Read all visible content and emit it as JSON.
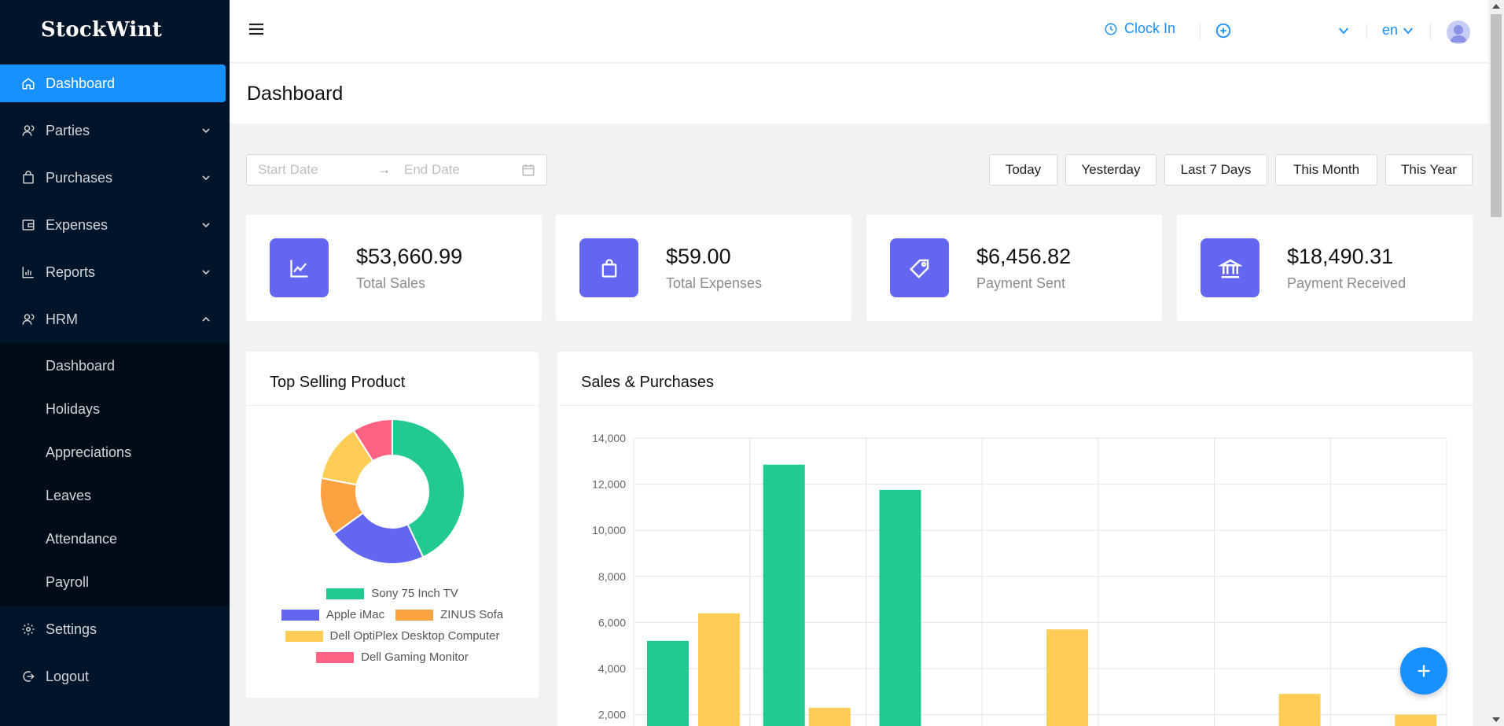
{
  "app": {
    "brand": "StockWint"
  },
  "sidebar": {
    "items": [
      {
        "label": "Dashboard",
        "icon": "home-icon",
        "active": true
      },
      {
        "label": "Parties",
        "icon": "users-icon",
        "expandable": true
      },
      {
        "label": "Purchases",
        "icon": "shopping-bag-icon",
        "expandable": true
      },
      {
        "label": "Expenses",
        "icon": "wallet-icon",
        "expandable": true
      },
      {
        "label": "Reports",
        "icon": "bar-chart-icon",
        "expandable": true
      },
      {
        "label": "HRM",
        "icon": "user-group-icon",
        "expandable": true,
        "expanded": true
      }
    ],
    "hrm_sub": [
      "Dashboard",
      "Holidays",
      "Appreciations",
      "Leaves",
      "Attendance",
      "Payroll"
    ],
    "bottom": [
      {
        "label": "Settings",
        "icon": "gear-icon"
      },
      {
        "label": "Logout",
        "icon": "logout-icon"
      }
    ]
  },
  "header": {
    "clock_in": "Clock In",
    "lang": "en"
  },
  "page": {
    "title": "Dashboard"
  },
  "filters": {
    "start_placeholder": "Start Date",
    "end_placeholder": "End Date",
    "arrow": "→",
    "quick": [
      "Today",
      "Yesterday",
      "Last 7 Days",
      "This Month",
      "This Year"
    ]
  },
  "stats": [
    {
      "value": "$53,660.99",
      "label": "Total Sales",
      "icon": "line-chart-icon"
    },
    {
      "value": "$59.00",
      "label": "Total Expenses",
      "icon": "shopping-bag-icon"
    },
    {
      "value": "$6,456.82",
      "label": "Payment Sent",
      "icon": "tag-icon"
    },
    {
      "value": "$18,490.31",
      "label": "Payment Received",
      "icon": "bank-icon"
    }
  ],
  "top_selling": {
    "title": "Top Selling Product",
    "legend": [
      {
        "name": "Sony 75 Inch TV",
        "color": "#22c993"
      },
      {
        "name": "Apple iMac",
        "color": "#6366f1"
      },
      {
        "name": "ZINUS Sofa",
        "color": "#fda240"
      },
      {
        "name": "Dell OptiPlex Desktop Computer",
        "color": "#ffcd56"
      },
      {
        "name": "Dell Gaming Monitor",
        "color": "#ff6384"
      }
    ]
  },
  "sales_purchases": {
    "title": "Sales & Purchases"
  },
  "colors": {
    "primary": "#1890ff",
    "sidebar": "#001529",
    "accent": "#6366f1",
    "green": "#22c993",
    "yellow": "#ffcd56"
  },
  "chart_data": [
    {
      "type": "pie",
      "labels": [
        "Sony 75 Inch TV",
        "Apple iMac",
        "ZINUS Sofa",
        "Dell OptiPlex Desktop Computer",
        "Dell Gaming Monitor"
      ],
      "values": [
        43,
        22,
        13,
        13,
        9
      ]
    },
    {
      "type": "bar",
      "categories": [
        "",
        "",
        "",
        "",
        "",
        "",
        ""
      ],
      "series": [
        {
          "values": [
            6400,
            0,
            0,
            5700,
            0,
            2900,
            2000
          ]
        },
        {
          "values": [
            5200,
            12850,
            11750,
            0,
            0,
            0,
            0
          ]
        },
        {
          "values": [
            0,
            2300,
            0,
            0,
            0,
            0,
            0
          ]
        }
      ],
      "yticks": [
        "2,000",
        "4,000",
        "6,000",
        "8,000",
        "10,000",
        "12,000",
        "14,000"
      ],
      "ylim": [
        0,
        14000
      ]
    }
  ]
}
